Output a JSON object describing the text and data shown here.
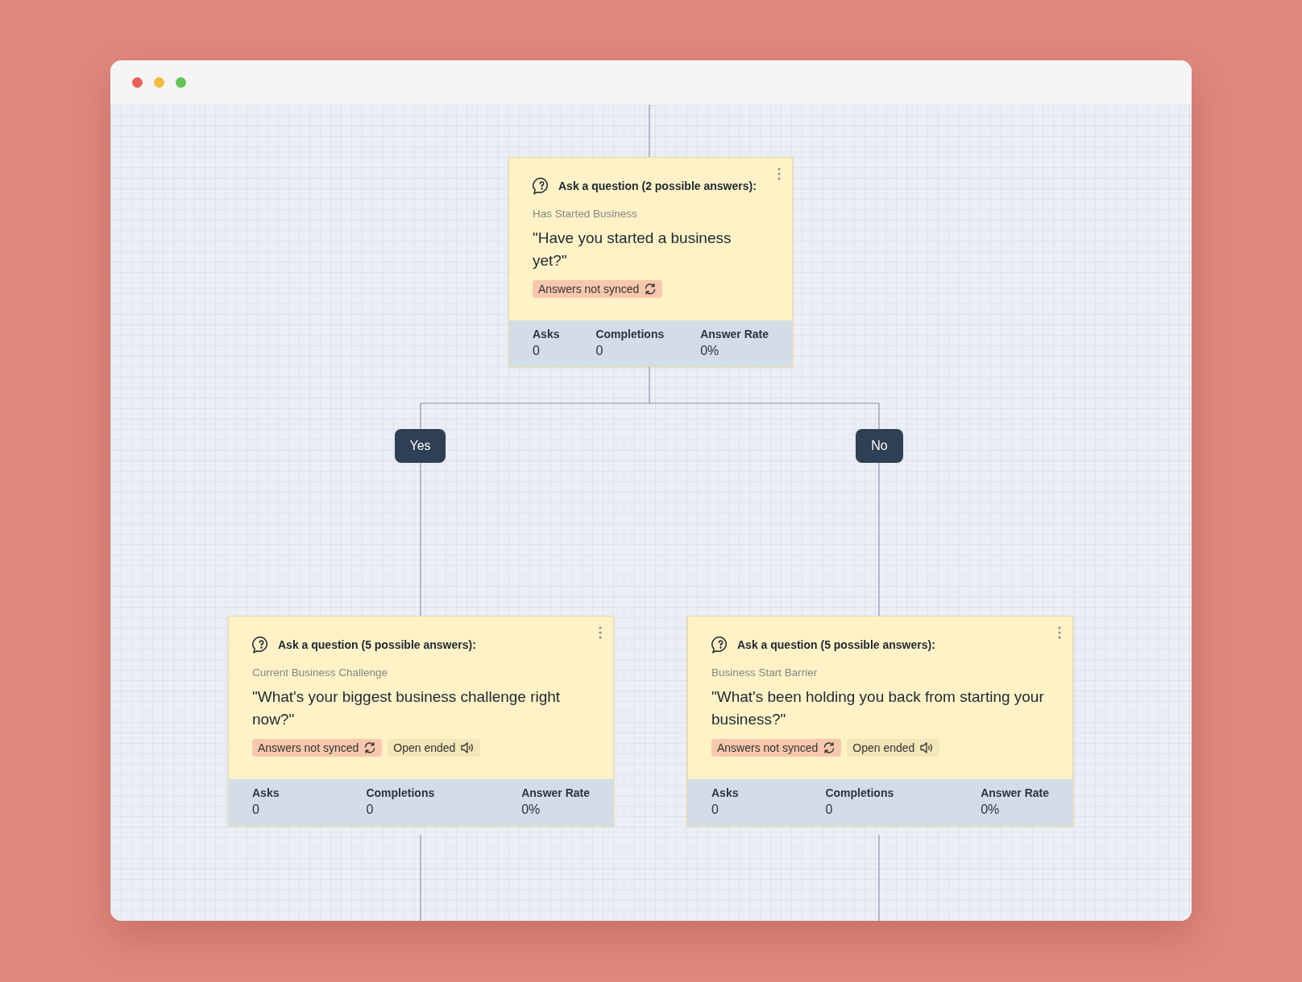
{
  "cards": [
    {
      "title": "Ask a question (2 possible answers):",
      "name": "Has Started Business",
      "question": "\"Have you started a business yet?\"",
      "tags": [
        {
          "kind": "sync",
          "label": "Answers not synced"
        }
      ],
      "stats": [
        {
          "label": "Asks",
          "value": "0"
        },
        {
          "label": "Completions",
          "value": "0"
        },
        {
          "label": "Answer Rate",
          "value": "0%"
        }
      ]
    },
    {
      "title": "Ask a question (5 possible answers):",
      "name": "Current Business Challenge",
      "question": "\"What's your biggest business challenge right now?\"",
      "tags": [
        {
          "kind": "sync",
          "label": "Answers not synced"
        },
        {
          "kind": "open_ended",
          "label": "Open ended"
        }
      ],
      "stats": [
        {
          "label": "Asks",
          "value": "0"
        },
        {
          "label": "Completions",
          "value": "0"
        },
        {
          "label": "Answer Rate",
          "value": "0%"
        }
      ]
    },
    {
      "title": "Ask a question (5 possible answers):",
      "name": "Business Start Barrier",
      "question": "\"What's been holding you back from starting your business?\"",
      "tags": [
        {
          "kind": "sync",
          "label": "Answers not synced"
        },
        {
          "kind": "open_ended",
          "label": "Open ended"
        }
      ],
      "stats": [
        {
          "label": "Asks",
          "value": "0"
        },
        {
          "label": "Completions",
          "value": "0"
        },
        {
          "label": "Answer Rate",
          "value": "0%"
        }
      ]
    }
  ],
  "branches": [
    {
      "label": "Yes"
    },
    {
      "label": "No"
    }
  ]
}
